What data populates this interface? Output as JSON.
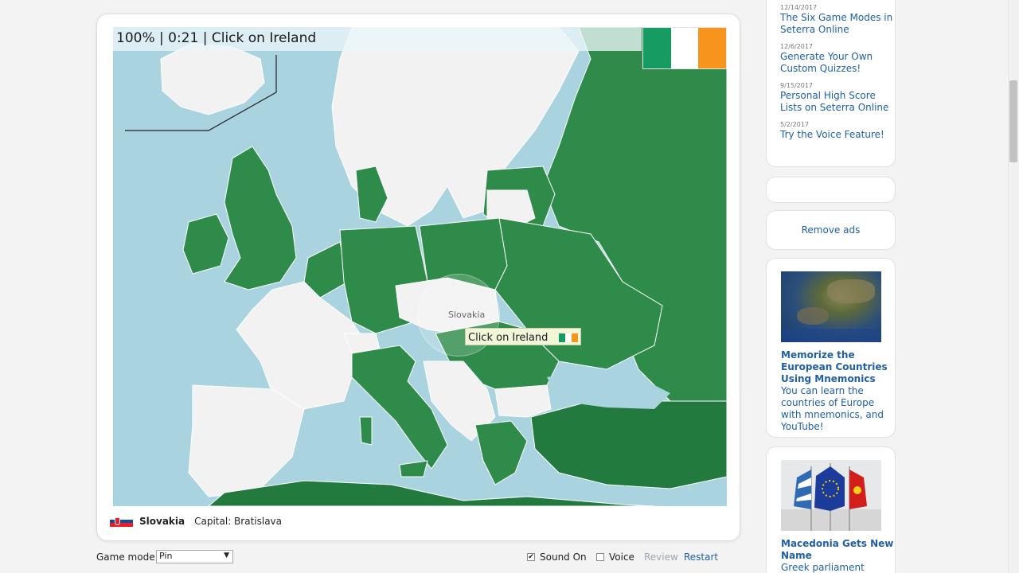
{
  "game": {
    "status_text": "100% | 0:21 | Click on Ireland",
    "map_label": "Slovakia",
    "tooltip_text": "Click on Ireland",
    "target_flag_colors": [
      "#169b62",
      "#ffffff",
      "#ff883e"
    ],
    "selected_country": "Slovakia",
    "capital_text": "Capital: Bratislava",
    "colors": {
      "sea": "#a8d3df",
      "answered": "#2e8b4a",
      "unanswered": "#f2f2f2",
      "border": "#ffffff"
    }
  },
  "controls": {
    "game_mode_label": "Game mode:",
    "game_mode_value": "Pin",
    "sound_label": "Sound On",
    "sound_checked": true,
    "voice_label": "Voice",
    "voice_checked": false,
    "review_label": "Review",
    "restart_label": "Restart"
  },
  "sidebar": {
    "news": [
      {
        "date": "12/14/2017",
        "title": "The Six Game Modes in Seterra Online"
      },
      {
        "date": "12/6/2017",
        "title": "Generate Your Own Custom Quizzes!"
      },
      {
        "date": "9/15/2017",
        "title": "Personal High Score Lists on Seterra Online"
      },
      {
        "date": "5/2/2017",
        "title": "Try the Voice Feature!"
      }
    ],
    "remove_ads": "Remove ads",
    "article1": {
      "title": "Memorize the European Countries Using Mnemonics",
      "text": "You can learn the countries of Europe with mnemonics, and YouTube!"
    },
    "article2": {
      "title": "Macedonia Gets New Name",
      "text": "Greek parliament ratifies name change"
    }
  }
}
